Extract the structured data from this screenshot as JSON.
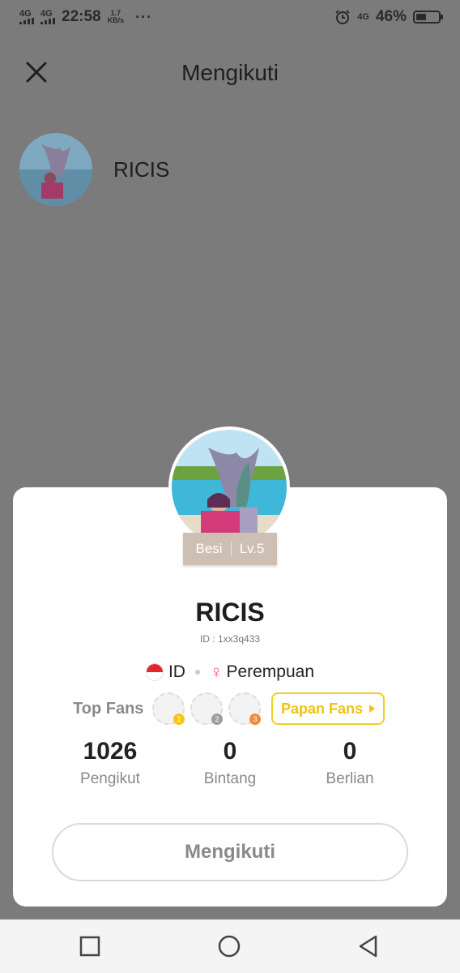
{
  "status_bar": {
    "signal1": "4G",
    "signal2": "4G",
    "time": "22:58",
    "speed_value": "1.7",
    "speed_unit": "KB/s",
    "more": "···",
    "network_right": "4G",
    "battery_percent": "46%",
    "battery_level": 0.46
  },
  "header": {
    "title": "Mengikuti",
    "close_icon": "close-icon"
  },
  "following_list": [
    {
      "name": "RICIS"
    }
  ],
  "profile": {
    "rank": "Besi",
    "level": "Lv.5",
    "name": "RICIS",
    "id_text": "ID : 1xx3q433",
    "country": "ID",
    "gender": "Perempuan",
    "top_fans_label": "Top Fans",
    "fan_medals": [
      "1",
      "2",
      "3"
    ],
    "fans_board_button": "Papan Fans",
    "stats": [
      {
        "value": "1026",
        "label": "Pengikut"
      },
      {
        "value": "0",
        "label": "Bintang"
      },
      {
        "value": "0",
        "label": "Berlian"
      }
    ],
    "follow_button": "Mengikuti"
  },
  "colors": {
    "overlay": "#7b7b7b",
    "accent_yellow": "#f0c30f",
    "level_badge": "#cdbfb3",
    "female_pink": "#e0559a"
  }
}
